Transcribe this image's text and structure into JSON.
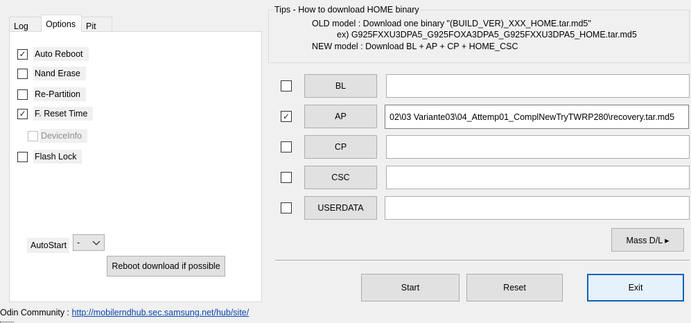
{
  "tabs": [
    {
      "label": "Log",
      "active": false
    },
    {
      "label": "Options",
      "active": true
    },
    {
      "label": "Pit",
      "active": false
    }
  ],
  "options": {
    "auto_reboot": {
      "label": "Auto Reboot",
      "checked": true
    },
    "nand_erase": {
      "label": "Nand Erase",
      "checked": false
    },
    "re_partition": {
      "label": "Re-Partition",
      "checked": false
    },
    "f_reset_time": {
      "label": "F. Reset Time",
      "checked": true
    },
    "device_info": {
      "label": "DeviceInfo",
      "checked": false,
      "disabled": true
    },
    "flash_lock": {
      "label": "Flash Lock",
      "checked": false
    }
  },
  "autostart": {
    "label": "AutoStart",
    "value": "-"
  },
  "reboot_download_button": "Reboot download if possible",
  "community": {
    "label": "Odin Community : ",
    "url": "http://mobilerndhub.sec.samsung.net/hub/site/"
  },
  "tips": {
    "title": "Tips - How to download HOME binary",
    "line1": "OLD model  : Download one binary    \"(BUILD_VER)_XXX_HOME.tar.md5\"",
    "line2": "ex) G925FXXU3DPA5_G925FOXA3DPA5_G925FXXU3DPA5_HOME.tar.md5",
    "line3": "NEW model : Download BL + AP + CP + HOME_CSC"
  },
  "files": [
    {
      "key": "bl",
      "button": "BL",
      "checked": false,
      "path": ""
    },
    {
      "key": "ap",
      "button": "AP",
      "checked": true,
      "path": "02\\03 Variante03\\04_Attemp01_ComplNewTryTWRP280\\recovery.tar.md5"
    },
    {
      "key": "cp",
      "button": "CP",
      "checked": false,
      "path": ""
    },
    {
      "key": "csc",
      "button": "CSC",
      "checked": false,
      "path": ""
    },
    {
      "key": "userdata",
      "button": "USERDATA",
      "checked": false,
      "path": ""
    }
  ],
  "mass_dl_button": "Mass D/L ▸",
  "actions": {
    "start": "Start",
    "reset": "Reset",
    "exit": "Exit"
  }
}
